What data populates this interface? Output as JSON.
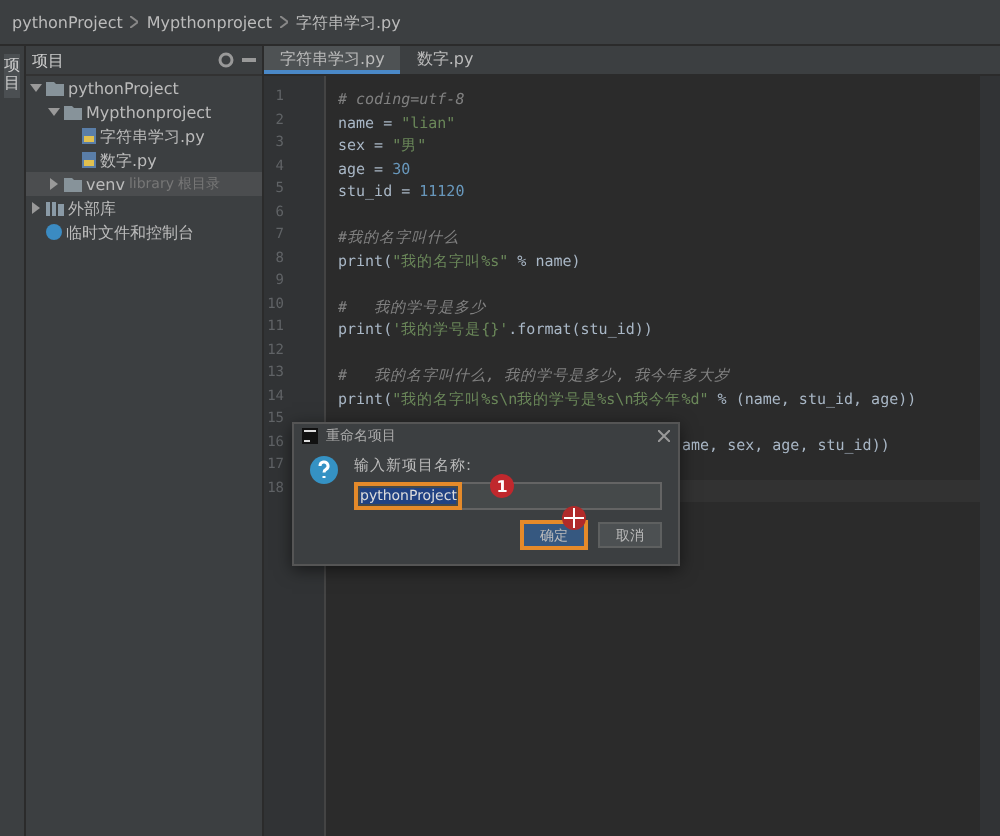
{
  "breadcrumb": [
    "pythonProject",
    "Mypthonproject",
    "字符串学习.py"
  ],
  "side_strip": {
    "label": "项目"
  },
  "project_panel": {
    "title": "项目",
    "tree": [
      {
        "label": "pythonProject",
        "kind": "folder",
        "expanded": true,
        "children": [
          {
            "label": "Mypthonproject",
            "kind": "folder",
            "expanded": true,
            "children": [
              {
                "label": "字符串学习.py",
                "kind": "file"
              },
              {
                "label": "数字.py",
                "kind": "file"
              }
            ]
          },
          {
            "label": "venv",
            "kind": "folder",
            "expanded": false,
            "selected": true,
            "note": "library 根目录"
          }
        ]
      },
      {
        "label": "外部库",
        "kind": "library",
        "expanded": false
      },
      {
        "label": "临时文件和控制台",
        "kind": "scratch"
      }
    ]
  },
  "tabs": [
    {
      "label": "字符串学习.py",
      "selected": true
    },
    {
      "label": "数字.py",
      "selected": false
    }
  ],
  "editor": {
    "lines": [
      {
        "num": "1",
        "tokens": [
          {
            "kind": "comment",
            "t": "# coding=utf-8"
          }
        ]
      },
      {
        "num": "2",
        "tokens": [
          {
            "kind": "code",
            "t": "name = "
          },
          {
            "kind": "str",
            "t": "\"lian\""
          }
        ]
      },
      {
        "num": "3",
        "tokens": [
          {
            "kind": "code",
            "t": "sex = "
          },
          {
            "kind": "str",
            "t": "\"男\""
          }
        ]
      },
      {
        "num": "4",
        "tokens": [
          {
            "kind": "code",
            "t": "age = "
          },
          {
            "kind": "num",
            "t": "30"
          }
        ]
      },
      {
        "num": "5",
        "tokens": [
          {
            "kind": "code",
            "t": "stu_id = "
          },
          {
            "kind": "num",
            "t": "11120"
          }
        ]
      },
      {
        "num": "6"
      },
      {
        "num": "7",
        "tokens": [
          {
            "kind": "comment",
            "t": "#我的名字叫什么"
          }
        ]
      },
      {
        "num": "8",
        "tokens": [
          {
            "kind": "code",
            "t": "print("
          },
          {
            "kind": "str",
            "t": "\"我的名字叫%s\""
          },
          {
            "kind": "code",
            "t": " % name)"
          }
        ]
      },
      {
        "num": "9"
      },
      {
        "num": "10",
        "tokens": [
          {
            "kind": "comment",
            "t": "#   我的学号是多少"
          }
        ]
      },
      {
        "num": "11",
        "tokens": [
          {
            "kind": "code",
            "t": "print("
          },
          {
            "kind": "str",
            "t": "'我的学号是{}'"
          },
          {
            "kind": "code",
            "t": ".format(stu_id))"
          }
        ]
      },
      {
        "num": "12"
      },
      {
        "num": "13",
        "tokens": [
          {
            "kind": "comment",
            "t": "#   我的名字叫什么, 我的学号是多少, 我今年多大岁"
          }
        ]
      },
      {
        "num": "14",
        "tokens": [
          {
            "kind": "code",
            "t": "print("
          },
          {
            "kind": "str",
            "t": "\"我的名字叫%s\\n我的学号是%s\\n我今年%d\""
          },
          {
            "kind": "code",
            "t": " % (name, stu_id, age))"
          }
        ]
      },
      {
        "num": "15"
      },
      {
        "num": "16",
        "covered": true,
        "tokens": [
          {
            "kind": "code",
            "t": "ame, sex, age, stu_id))"
          }
        ]
      },
      {
        "num": "17"
      },
      {
        "num": "18",
        "current": true
      }
    ]
  },
  "dialog": {
    "title": "重命名项目",
    "prompt": "输入新项目名称:",
    "value": "pythonProject",
    "badge": "1",
    "buttons": [
      {
        "label": "确定",
        "selected": true
      },
      {
        "label": "取消",
        "selected": false
      }
    ]
  }
}
